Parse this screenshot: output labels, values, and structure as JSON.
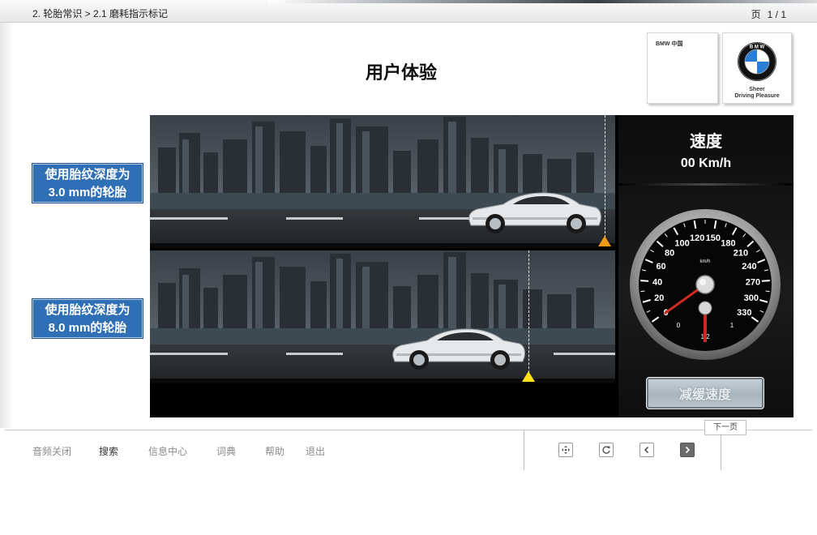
{
  "header": {
    "breadcrumb": "2. 轮胎常识 > 2.1 磨耗指示标记",
    "page_label": "页",
    "page_number": "1 / 1"
  },
  "page_title": "用户体验",
  "logos": {
    "cn_label": "BMW 中国",
    "slogan_line1": "Sheer",
    "slogan_line2": "Driving Pleasure"
  },
  "labels": {
    "tire_a": [
      "使用胎纹深度为",
      "3.0 mm的轮胎"
    ],
    "tire_b": [
      "使用胎纹深度为",
      "8.0 mm的轮胎"
    ]
  },
  "speed_panel": {
    "title": "速度",
    "value": "00 Km/h",
    "gauge_unit": "km/h",
    "gauge_ticks": [
      "0",
      "20",
      "40",
      "60",
      "80",
      "100",
      "120",
      "150",
      "180",
      "210",
      "240",
      "270",
      "300",
      "330"
    ],
    "fuel_ticks": [
      "0",
      "1/2",
      "1"
    ],
    "slow_button_label": "减缓速度"
  },
  "footer": {
    "nav": [
      {
        "label": "音频关闭",
        "active": false
      },
      {
        "label": "搜索",
        "active": true
      },
      {
        "label": "信息中心",
        "active": false
      },
      {
        "label": "词典",
        "active": false
      },
      {
        "label": "帮助",
        "active": false
      },
      {
        "label": "退出",
        "active": false
      }
    ],
    "next_tooltip": "下一页"
  },
  "colors": {
    "label_blue": "#2f6fb5",
    "marker_orange": "#f09a1a",
    "marker_yellow": "#ffe21a",
    "needle_red": "#d12a1e"
  },
  "icons": [
    "view-toggle-icon",
    "replay-icon",
    "chevron-left-icon",
    "chevron-right-icon",
    "bmw-roundel-icon"
  ]
}
